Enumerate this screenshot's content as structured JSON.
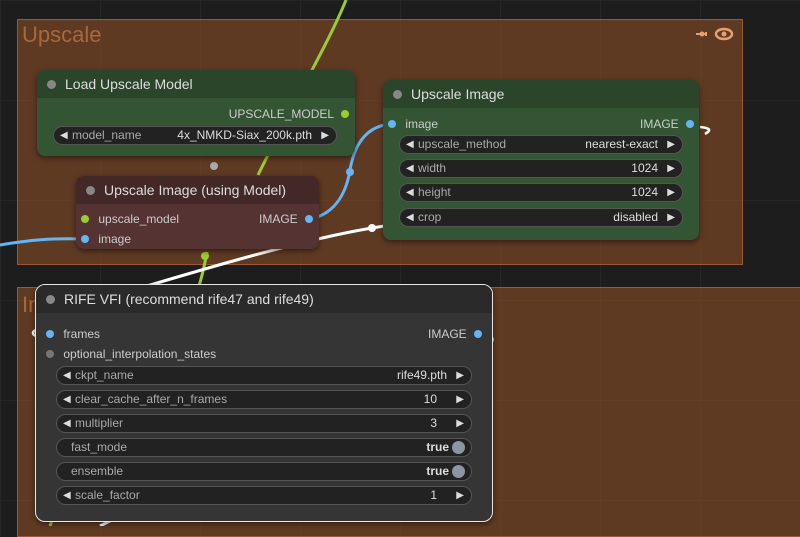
{
  "colors": {
    "canvas_bg": "#1d1d1d",
    "group_bg": "#9c5a30",
    "node_green": "#335533",
    "node_red": "#553333",
    "node_dark": "#353535",
    "link_green": "#9acd32",
    "link_blue": "#64b5f6",
    "link_white": "#ffffff"
  },
  "groups": [
    {
      "title": "Upscale",
      "tools_icon": "group-options-icon"
    },
    {
      "title": "In"
    }
  ],
  "nodes": {
    "load_upscale_model": {
      "title": "Load Upscale Model",
      "output": "UPSCALE_MODEL",
      "widgets": [
        {
          "name": "model_name",
          "value": "4x_NMKD-Siax_200k.pth"
        }
      ]
    },
    "upscale_image_using_model": {
      "title": "Upscale Image (using Model)",
      "inputs": [
        "upscale_model",
        "image"
      ],
      "output": "IMAGE"
    },
    "upscale_image": {
      "title": "Upscale Image",
      "inputs": [
        "image"
      ],
      "output": "IMAGE",
      "widgets": [
        {
          "name": "upscale_method",
          "value": "nearest-exact"
        },
        {
          "name": "width",
          "value": "1024"
        },
        {
          "name": "height",
          "value": "1024"
        },
        {
          "name": "crop",
          "value": "disabled"
        }
      ]
    },
    "rife_vfi": {
      "title": "RIFE VFI (recommend rife47 and rife49)",
      "inputs": [
        "frames",
        "optional_interpolation_states"
      ],
      "output": "IMAGE",
      "widgets": [
        {
          "name": "ckpt_name",
          "value": "rife49.pth",
          "kind": "combo"
        },
        {
          "name": "clear_cache_after_n_frames",
          "value": "10",
          "kind": "number"
        },
        {
          "name": "multiplier",
          "value": "3",
          "kind": "number"
        },
        {
          "name": "fast_mode",
          "value": "true",
          "kind": "toggle"
        },
        {
          "name": "ensemble",
          "value": "true",
          "kind": "toggle"
        },
        {
          "name": "scale_factor",
          "value": "1",
          "kind": "number"
        }
      ]
    }
  }
}
